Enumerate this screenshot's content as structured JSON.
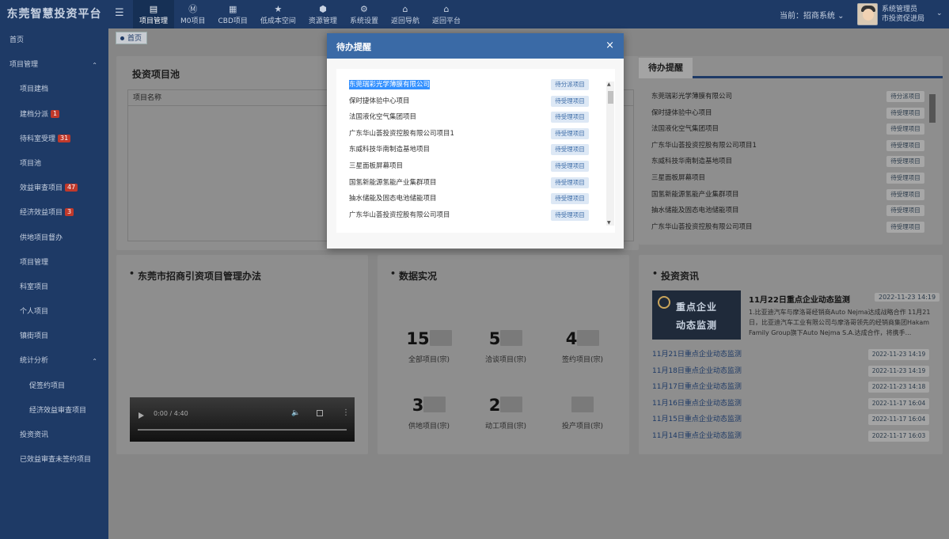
{
  "brand": "东莞智慧投资平台",
  "nav": [
    {
      "icon": "▤",
      "label": "项目管理",
      "active": true
    },
    {
      "icon": "Ⓜ",
      "label": "M0项目"
    },
    {
      "icon": "▦",
      "label": "CBD项目"
    },
    {
      "icon": "★",
      "label": "低成本空间"
    },
    {
      "icon": "⬢",
      "label": "资源管理"
    },
    {
      "icon": "⚙",
      "label": "系统设置"
    },
    {
      "icon": "⌂",
      "label": "返回导航"
    },
    {
      "icon": "⌂",
      "label": "返回平台"
    }
  ],
  "header": {
    "current": "当前：招商系统 ⌄",
    "user_role": "系统管理员",
    "user_dept": "市投资促进局"
  },
  "sidebar": [
    {
      "label": "首页",
      "level": 1
    },
    {
      "label": "项目管理",
      "level": 1,
      "caret": "⌃"
    },
    {
      "label": "项目建档",
      "level": 2
    },
    {
      "label": "建档分派",
      "level": 2,
      "badge": "1"
    },
    {
      "label": "待科室受理",
      "level": 2,
      "badge": "31"
    },
    {
      "label": "项目池",
      "level": 2
    },
    {
      "label": "效益审查项目",
      "level": 2,
      "badge": "47"
    },
    {
      "label": "经济效益项目",
      "level": 2,
      "badge": "3"
    },
    {
      "label": "供地项目督办",
      "level": 2
    },
    {
      "label": "项目管理",
      "level": 2
    },
    {
      "label": "科室项目",
      "level": 2
    },
    {
      "label": "个人项目",
      "level": 2
    },
    {
      "label": "镇街项目",
      "level": 2
    },
    {
      "label": "统计分析",
      "level": 2,
      "caret": "⌃"
    },
    {
      "label": "促签约项目",
      "level": 3
    },
    {
      "label": "经济效益审查项目",
      "level": 3
    },
    {
      "label": "投资资讯",
      "level": 2
    },
    {
      "label": "已效益审查未签约项目",
      "level": 2
    }
  ],
  "breadcrumb": "首页",
  "pool": {
    "title": "投资项目池",
    "col_name": "项目名称"
  },
  "todo": {
    "tab": "待办提醒",
    "items": [
      {
        "name": "东莞瑞彩光学薄膜有限公司",
        "tag": "待分派项目"
      },
      {
        "name": "保时捷体验中心项目",
        "tag": "待受理项目"
      },
      {
        "name": "法国液化空气集团项目",
        "tag": "待受理项目"
      },
      {
        "name": "广东华山荟投资控股有限公司项目1",
        "tag": "待受理项目"
      },
      {
        "name": "东威科技华南制造基地项目",
        "tag": "待受理项目"
      },
      {
        "name": "三星面板屏幕项目",
        "tag": "待受理项目"
      },
      {
        "name": "国氢新能源氢能产业集群项目",
        "tag": "待受理项目"
      },
      {
        "name": "抽水储能及固态电池储能项目",
        "tag": "待受理项目"
      },
      {
        "name": "广东华山荟投资控股有限公司项目",
        "tag": "待受理项目"
      }
    ]
  },
  "policy": {
    "title": "东莞市招商引资项目管理办法",
    "video_time": "0:00 / 4:40"
  },
  "stats": {
    "title": "数据实况",
    "items": [
      {
        "num": "15",
        "label": "全部项目(宗)"
      },
      {
        "num": "5",
        "label": "洽谈项目(宗)"
      },
      {
        "num": "4",
        "label": "签约项目(宗)"
      },
      {
        "num": "3",
        "label": "供地项目(宗)"
      },
      {
        "num": "2",
        "label": "动工项目(宗)"
      },
      {
        "num": "",
        "label": "投产项目(宗)"
      }
    ]
  },
  "news": {
    "title": "投资资讯",
    "img_line1": "重点企业",
    "img_line2": "动态监测",
    "headline": "11月22日重点企业动态监测",
    "headline_date": "2022-11-23 14:19",
    "body": "1.比亚迪汽车与摩洛哥经销商Auto Nejma达成战略合作 11月21日，比亚迪汽车工业有限公司与摩洛哥领先的经销商集团Hakam Family Group旗下Auto Nejma S.A.达成合作，将携手...",
    "items": [
      {
        "title": "11月21日重点企业动态监测",
        "date": "2022-11-23 14:19"
      },
      {
        "title": "11月18日重点企业动态监测",
        "date": "2022-11-23 14:19"
      },
      {
        "title": "11月17日重点企业动态监测",
        "date": "2022-11-23 14:18"
      },
      {
        "title": "11月16日重点企业动态监测",
        "date": "2022-11-17 16:04"
      },
      {
        "title": "11月15日重点企业动态监测",
        "date": "2022-11-17 16:04"
      },
      {
        "title": "11月14日重点企业动态监测",
        "date": "2022-11-17 16:03"
      }
    ]
  },
  "modal": {
    "title": "待办提醒",
    "close": "×",
    "items": [
      {
        "name": "东莞瑞彩光学薄膜有限公司",
        "tag": "待分派项目",
        "selected": true
      },
      {
        "name": "保时捷体验中心项目",
        "tag": "待受理项目"
      },
      {
        "name": "法国液化空气集团项目",
        "tag": "待受理项目"
      },
      {
        "name": "广东华山荟投资控股有限公司项目1",
        "tag": "待受理项目"
      },
      {
        "name": "东威科技华南制造基地项目",
        "tag": "待受理项目"
      },
      {
        "name": "三星面板屏幕项目",
        "tag": "待受理项目"
      },
      {
        "name": "国氢新能源氢能产业集群项目",
        "tag": "待受理项目"
      },
      {
        "name": "抽水储能及固态电池储能项目",
        "tag": "待受理项目"
      },
      {
        "name": "广东华山荟投资控股有限公司项目",
        "tag": "待受理项目"
      }
    ]
  }
}
